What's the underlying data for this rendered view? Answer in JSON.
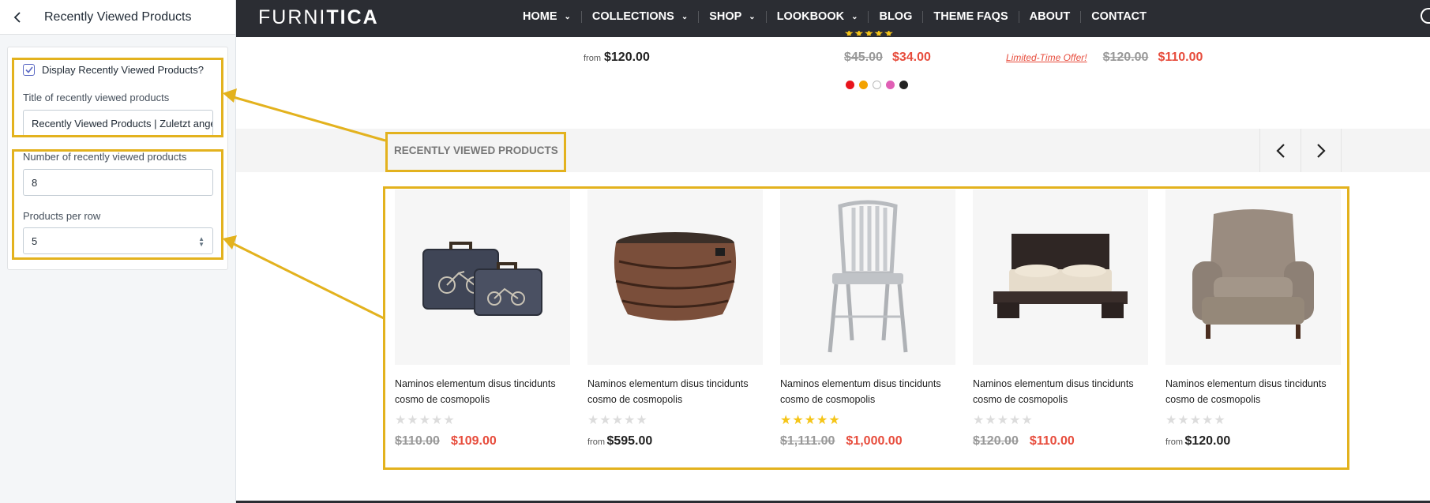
{
  "panel": {
    "title": "Recently Viewed Products",
    "display_checkbox_label": "Display Recently Viewed Products?",
    "display_checked": true,
    "title_field_label": "Title of recently viewed products",
    "title_field_value": "Recently Viewed Products | Zuletzt ange",
    "number_label": "Number of recently viewed products",
    "number_value": "8",
    "per_row_label": "Products per row",
    "per_row_value": "5"
  },
  "store": {
    "logo_light": "FURNI",
    "logo_bold": "TICA",
    "nav": [
      {
        "label": "HOME",
        "dropdown": true
      },
      {
        "label": "COLLECTIONS",
        "dropdown": true
      },
      {
        "label": "SHOP",
        "dropdown": true
      },
      {
        "label": "LOOKBOOK",
        "dropdown": true
      },
      {
        "label": "BLOG",
        "dropdown": false
      },
      {
        "label": "THEME FAQS",
        "dropdown": false
      },
      {
        "label": "ABOUT",
        "dropdown": false
      },
      {
        "label": "CONTACT",
        "dropdown": false
      }
    ],
    "prev_row": {
      "item1_from": "from",
      "item1_price": "$120.00",
      "item2_old": "$45.00",
      "item2_sale": "$34.00",
      "item3_offer": "Limited-Time Offer!",
      "item3_old": "$120.00",
      "item3_sale": "$110.00",
      "swatch_colors": [
        "#e8141c",
        "#f3a200",
        "#ffffff",
        "#e05fb5",
        "#222222"
      ]
    },
    "recently_viewed": {
      "title": "RECENTLY VIEWED PRODUCTS",
      "prev_arrow": "‹",
      "next_arrow": "›",
      "products": [
        {
          "name": "Naminos elementum disus tincidunts cosmo de cosmopolis",
          "rated": false,
          "from": "",
          "old": "$110.00",
          "price": "$109.00",
          "sale": true,
          "icon": "suitcase-image"
        },
        {
          "name": "Naminos elementum disus tincidunts cosmo de cosmopolis",
          "rated": false,
          "from": "from",
          "old": "",
          "price": "$595.00",
          "sale": false,
          "icon": "wicker-table-image"
        },
        {
          "name": "Naminos elementum disus tincidunts cosmo de cosmopolis",
          "rated": true,
          "from": "",
          "old": "$1,111.00",
          "price": "$1,000.00",
          "sale": true,
          "icon": "chair-image"
        },
        {
          "name": "Naminos elementum disus tincidunts cosmo de cosmopolis",
          "rated": false,
          "from": "",
          "old": "$120.00",
          "price": "$110.00",
          "sale": true,
          "icon": "bed-image"
        },
        {
          "name": "Naminos elementum disus tincidunts cosmo de cosmopolis",
          "rated": false,
          "from": "from",
          "old": "",
          "price": "$120.00",
          "sale": false,
          "icon": "armchair-image"
        }
      ]
    }
  },
  "colors": {
    "highlight": "#e3b21e",
    "nav_bg": "#2b2d33",
    "sale_red": "#e74c3c",
    "star_gold": "#f5c518",
    "checkbox_accent": "#5c6ac4"
  }
}
